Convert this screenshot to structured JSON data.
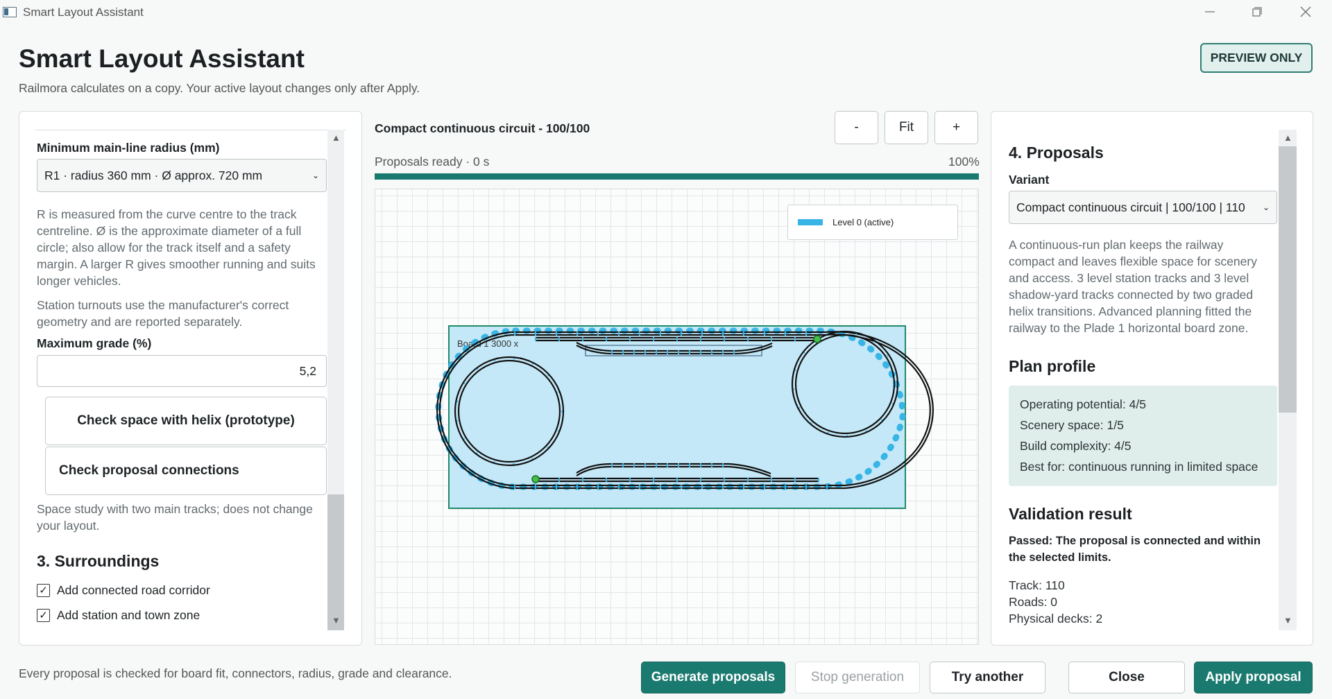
{
  "window": {
    "title": "Smart Layout Assistant"
  },
  "header": {
    "title": "Smart Layout Assistant",
    "subtitle": "Railmora calculates on a copy. Your active layout changes only after Apply.",
    "badge": "PREVIEW ONLY"
  },
  "left": {
    "radius_label": "Minimum main-line radius (mm)",
    "radius_value": "R1 · radius 360 mm · Ø approx. 720 mm",
    "radius_help": [
      "R is measured from the curve centre to the track",
      "centreline. Ø is the approximate diameter of a full",
      "circle; also allow for the track itself and a safety",
      "margin. A larger R gives smoother running and suits",
      "longer vehicles."
    ],
    "turnout_help": [
      "Station turnouts use the manufacturer's correct",
      "geometry and are reported separately."
    ],
    "grade_label": "Maximum grade (%)",
    "grade_value": "5,2",
    "helix_button": "Check space with helix (prototype)",
    "connections_button": "Check proposal connections",
    "space_note": [
      "Space study with two main tracks; does not change",
      "your layout."
    ],
    "surroundings_title": "3. Surroundings",
    "checkbox_road": "Add connected road corridor",
    "checkbox_town": "Add station and town zone"
  },
  "center": {
    "title": "Compact continuous circuit - 100/100",
    "zoom_out": "-",
    "zoom_fit": "Fit",
    "zoom_in": "+",
    "status": "Proposals ready · 0 s",
    "progress_label": "100%",
    "progress_value": 1.0,
    "legend_label": "Level 0 (active)",
    "board_label": "Board 1  3000 x"
  },
  "right": {
    "proposals_title": "4. Proposals",
    "variant_label": "Variant",
    "variant_value": "Compact continuous circuit | 100/100 | 110",
    "description": [
      "A continuous-run plan keeps the railway",
      "compact and leaves flexible space for scenery",
      "and access. 3 level station tracks and 3 level",
      "shadow-yard tracks connected by two graded",
      "helix transitions. Advanced planning fitted the",
      "railway to the Plade 1 horizontal board zone."
    ],
    "profile_title": "Plan profile",
    "profile": [
      "Operating potential: 4/5",
      "Scenery space: 1/5",
      "Build complexity: 4/5",
      "Best for: continuous running in limited space"
    ],
    "validation_title": "Validation result",
    "validation_passed": [
      "Passed: The proposal is connected and within",
      "the selected limits."
    ],
    "stats": [
      "Track: 110",
      "Roads: 0",
      "Physical decks: 2"
    ]
  },
  "footer": {
    "note": "Every proposal is checked for board fit, connectors, radius, grade and clearance.",
    "generate": "Generate proposals",
    "stop": "Stop generation",
    "try_another": "Try another",
    "close": "Close",
    "apply": "Apply proposal"
  },
  "colors": {
    "accent": "#1b7a70",
    "board_fill": "#c4e8f7",
    "track_tie": "#38b4e6"
  }
}
